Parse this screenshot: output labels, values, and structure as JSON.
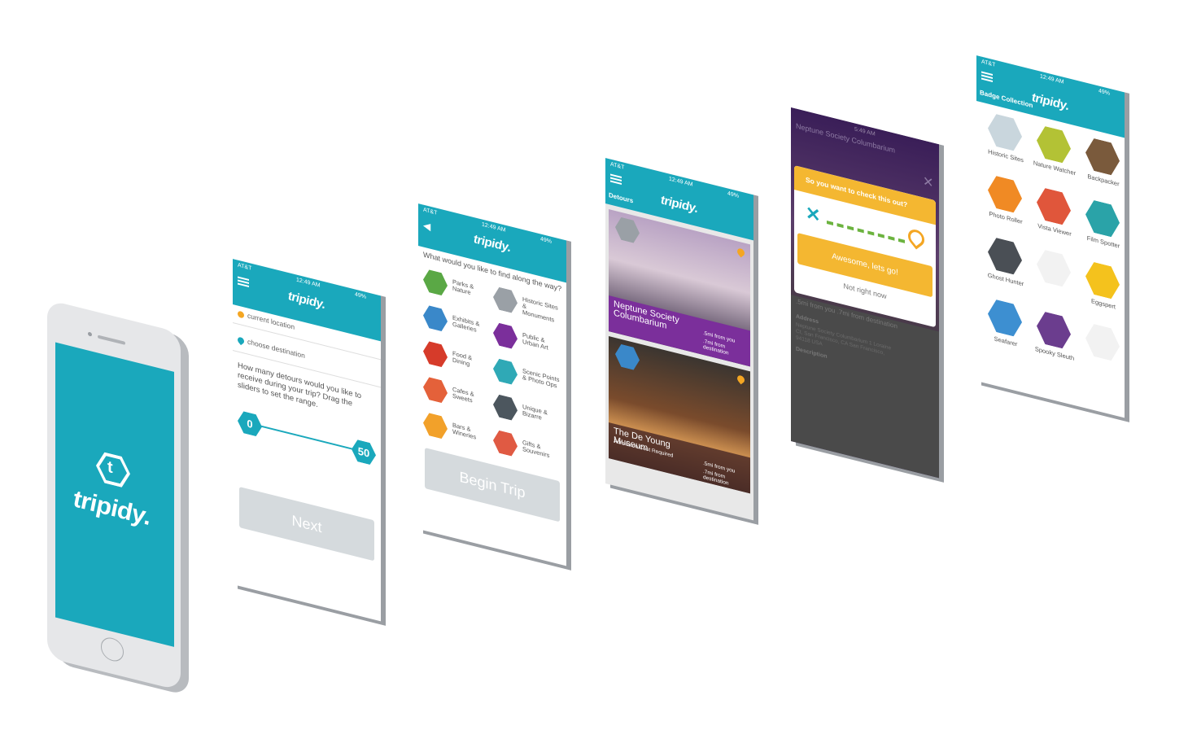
{
  "brand": {
    "name": "tripidy",
    "teal": "#1aa8bc",
    "purple": "#7b2f9b",
    "orange": "#f4a623"
  },
  "status": {
    "carrier": "AT&T",
    "time": "12:49 AM",
    "battery": "49%"
  },
  "popup_status": {
    "time": "5:49 AM"
  },
  "phone": {
    "logo": "tripidy."
  },
  "screen1": {
    "logo": "tripidy.",
    "start": "current location",
    "destination": "choose destination",
    "question": "How many detours would you like to receive during your trip? Drag the sliders to set the range.",
    "slider_min": "0",
    "slider_max": "50",
    "next": "Next"
  },
  "screen2": {
    "logo": "tripidy.",
    "prompt": "What would you like to find along the way?",
    "categories": [
      {
        "label": "Parks & Nature",
        "color": "#5aa845",
        "icon": "tree-icon"
      },
      {
        "label": "Historic Sites & Monuments",
        "color": "#9aa0a6",
        "icon": "column-building-icon"
      },
      {
        "label": "Exhibits & Galleries",
        "color": "#3a88c9",
        "icon": "picture-icon"
      },
      {
        "label": "Public & Urban Art",
        "color": "#7b2f9b",
        "icon": "spray-can-icon"
      },
      {
        "label": "Food & Dining",
        "color": "#d63b2a",
        "icon": "fork-knife-icon"
      },
      {
        "label": "Scenic Points & Photo Ops",
        "color": "#2fa9b6",
        "icon": "camera-icon"
      },
      {
        "label": "Cafes & Sweets",
        "color": "#e4613a",
        "icon": "cup-icon"
      },
      {
        "label": "Unique & Bizarre",
        "color": "#4c565e",
        "icon": "eye-icon"
      },
      {
        "label": "Bars & Wineries",
        "color": "#f2a12a",
        "icon": "wine-icon"
      },
      {
        "label": "Gifts & Souvenirs",
        "color": "#e05a43",
        "icon": "gift-icon"
      }
    ],
    "begin": "Begin Trip"
  },
  "screen3": {
    "title": "Detours",
    "logo": "tripidy.",
    "cards": [
      {
        "name": "Neptune Society Columbarium",
        "from_you": ".5mi from you",
        "from_dest": ".7mi from destination",
        "icon": "column-building-icon"
      },
      {
        "name": "The De Young Museum",
        "sub": "Admission Cost Required",
        "from_you": ".5mi from you",
        "from_dest": ".7mi from destination",
        "icon": "picture-icon"
      }
    ]
  },
  "screen4": {
    "bg_title": "Neptune Society Columbarium",
    "popup_title": "So you want to check this out?",
    "confirm": "Awesome, lets go!",
    "dismiss": "Not right now",
    "distance": ".5mi from you .7mi from destination",
    "address_label": "Address",
    "address": "Neptune Society Columbarium 1 Loraine Ct, San Francisco, CA San Francisco, 94118 USA",
    "description_label": "Description"
  },
  "screen5": {
    "title": "Badge Collection",
    "logo": "tripidy.",
    "badges": [
      {
        "label": "Historic Sites",
        "color": "#c9d6dd",
        "icon": "monument-icon"
      },
      {
        "label": "Nature Watcher",
        "color": "#b3c235",
        "icon": "binoculars-icon"
      },
      {
        "label": "Backpacker",
        "color": "#7a5a3c",
        "icon": "backpack-icon"
      },
      {
        "label": "Photo Roller",
        "color": "#f08a24",
        "icon": "film-roll-icon"
      },
      {
        "label": "Vista Viewer",
        "color": "#e0563b",
        "icon": "bridge-icon"
      },
      {
        "label": "Film Spotter",
        "color": "#2aa3a8",
        "icon": "movie-camera-icon"
      },
      {
        "label": "Ghost Hunter",
        "color": "#4a4f55",
        "icon": "ghost-icon"
      },
      {
        "label": "",
        "color": "",
        "icon": "empty-badge-icon"
      },
      {
        "label": "Eggspert",
        "color": "#f4c21d",
        "icon": "egg-icon"
      },
      {
        "label": "Seafarer",
        "color": "#3d8fd1",
        "icon": "ship-icon"
      },
      {
        "label": "Spooky Sleuth",
        "color": "#6b3d8e",
        "icon": "skull-icon"
      },
      {
        "label": "",
        "color": "",
        "icon": "empty-badge-icon"
      }
    ]
  }
}
